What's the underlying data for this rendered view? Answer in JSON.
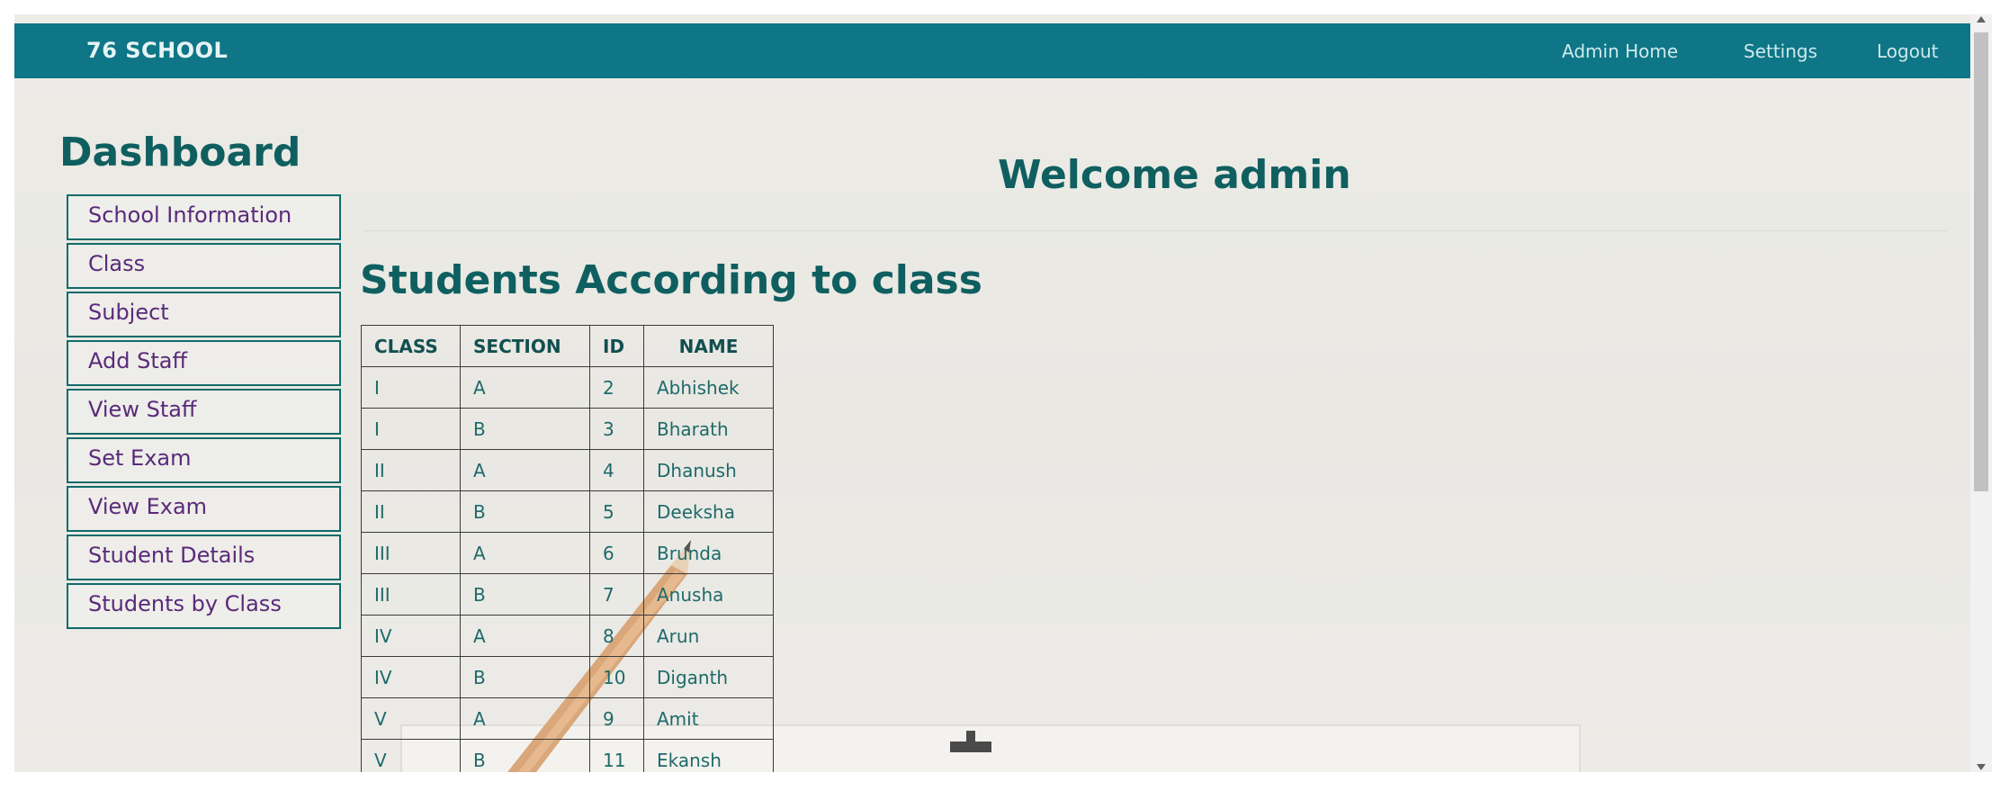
{
  "navbar": {
    "brand": "76 SCHOOL",
    "links": [
      {
        "label": "Admin Home"
      },
      {
        "label": "Settings"
      },
      {
        "label": "Logout"
      }
    ]
  },
  "sidebar": {
    "title": "Dashboard",
    "items": [
      {
        "label": "School Information"
      },
      {
        "label": "Class"
      },
      {
        "label": "Subject"
      },
      {
        "label": "Add Staff"
      },
      {
        "label": "View Staff"
      },
      {
        "label": "Set Exam"
      },
      {
        "label": "View Exam"
      },
      {
        "label": "Student Details"
      },
      {
        "label": "Students by Class"
      }
    ]
  },
  "main": {
    "welcome": "Welcome admin",
    "section_title": "Students According to class",
    "table": {
      "headers": [
        "CLASS",
        "SECTION",
        "ID",
        "NAME"
      ],
      "rows": [
        [
          "I",
          "A",
          "2",
          "Abhishek"
        ],
        [
          "I",
          "B",
          "3",
          "Bharath"
        ],
        [
          "II",
          "A",
          "4",
          "Dhanush"
        ],
        [
          "II",
          "B",
          "5",
          "Deeksha"
        ],
        [
          "III",
          "A",
          "6",
          "Brunda"
        ],
        [
          "III",
          "B",
          "7",
          "Anusha"
        ],
        [
          "IV",
          "A",
          "8",
          "Arun"
        ],
        [
          "IV",
          "B",
          "10",
          "Diganth"
        ],
        [
          "V",
          "A",
          "9",
          "Amit"
        ],
        [
          "V",
          "B",
          "11",
          "Ekansh"
        ]
      ]
    }
  },
  "colors": {
    "navbar": "#0e7686",
    "heading": "#0f5f60",
    "sidebar_text": "#5a2a7a",
    "sidebar_border": "#0f6b6a"
  }
}
